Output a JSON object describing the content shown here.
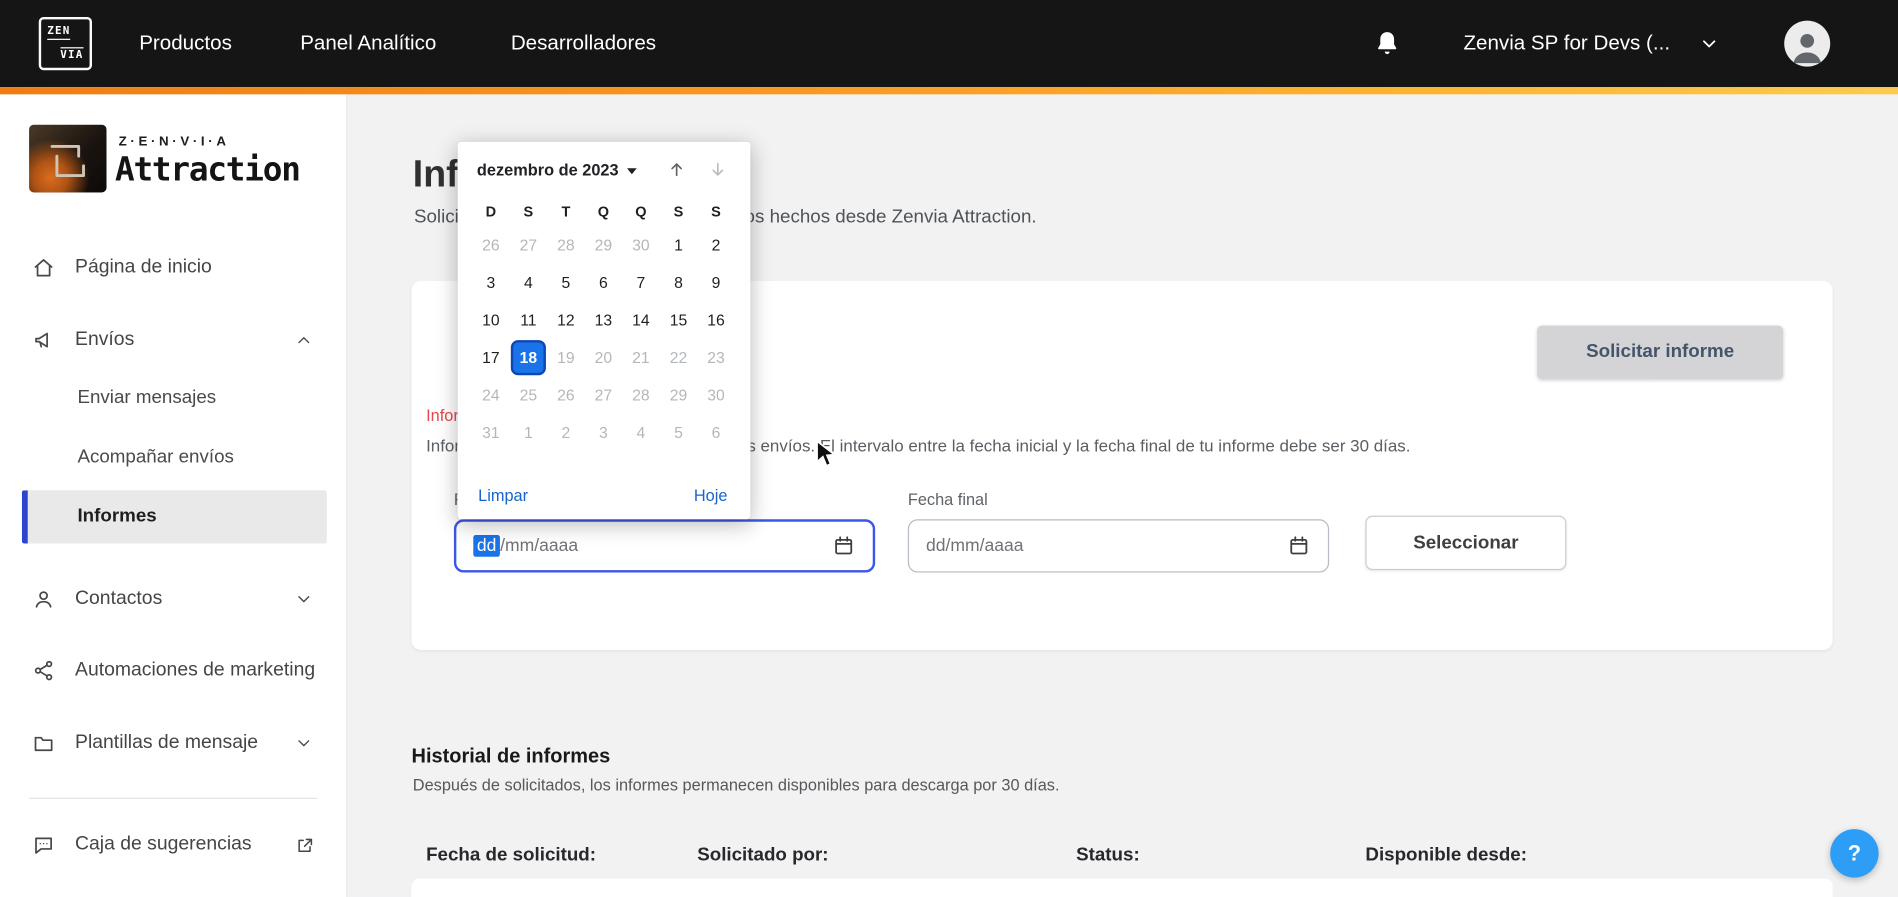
{
  "navbar": {
    "logo_top": "ZEN",
    "logo_bottom": "VIA",
    "items": [
      "Productos",
      "Panel Analítico",
      "Desarrolladores"
    ],
    "account_label": "Zenvia SP for Devs (..."
  },
  "sidebar": {
    "brand_small": "Z·E·N·V·I·A",
    "brand_large": "Attraction",
    "home": "Página de inicio",
    "envios": "Envíos",
    "sub": [
      "Enviar mensajes",
      "Acompañar envíos",
      "Informes"
    ],
    "contactos": "Contactos",
    "automations": "Automaciones de marketing",
    "templates": "Plantillas de mensaje",
    "suggestions": "Caja de sugerencias"
  },
  "page": {
    "title": "Informes de envío",
    "subtitle": "Solicita y descarga los informes de envíos hechos desde Zenvia Attraction."
  },
  "card": {
    "request_button": "Solicitar informe",
    "error_text": "Informa el período de envíos",
    "description": "Informa el período que deseas consultar los envíos. El intervalo entre la fecha inicial y la fecha final de tu informe debe ser 30 días.",
    "start_label": "Fecha inicial",
    "end_label": "Fecha final",
    "dd": "dd",
    "rest": "/mm/aaaa",
    "end_placeholder": "dd/mm/aaaa",
    "select_button": "Seleccionar"
  },
  "calendar": {
    "month_label": "dezembro de 2023",
    "weekdays": [
      "D",
      "S",
      "T",
      "Q",
      "Q",
      "S",
      "S"
    ],
    "days": [
      {
        "d": 26,
        "m": 1
      },
      {
        "d": 27,
        "m": 1
      },
      {
        "d": 28,
        "m": 1
      },
      {
        "d": 29,
        "m": 1
      },
      {
        "d": 30,
        "m": 1
      },
      {
        "d": 1
      },
      {
        "d": 2
      },
      {
        "d": 3
      },
      {
        "d": 4
      },
      {
        "d": 5
      },
      {
        "d": 6
      },
      {
        "d": 7
      },
      {
        "d": 8
      },
      {
        "d": 9
      },
      {
        "d": 10
      },
      {
        "d": 11
      },
      {
        "d": 12
      },
      {
        "d": 13
      },
      {
        "d": 14
      },
      {
        "d": 15
      },
      {
        "d": 16
      },
      {
        "d": 17
      },
      {
        "d": 18,
        "sel": 1
      },
      {
        "d": 19,
        "m": 1
      },
      {
        "d": 20,
        "m": 1
      },
      {
        "d": 21,
        "m": 1
      },
      {
        "d": 22,
        "m": 1
      },
      {
        "d": 23,
        "m": 1
      },
      {
        "d": 24,
        "m": 1
      },
      {
        "d": 25,
        "m": 1
      },
      {
        "d": 26,
        "m": 1
      },
      {
        "d": 27,
        "m": 1
      },
      {
        "d": 28,
        "m": 1
      },
      {
        "d": 29,
        "m": 1
      },
      {
        "d": 30,
        "m": 1
      },
      {
        "d": 31,
        "m": 1
      },
      {
        "d": 1,
        "m": 1
      },
      {
        "d": 2,
        "m": 1
      },
      {
        "d": 3,
        "m": 1
      },
      {
        "d": 4,
        "m": 1
      },
      {
        "d": 5,
        "m": 1
      },
      {
        "d": 6,
        "m": 1
      }
    ],
    "clear_label": "Limpar",
    "today_label": "Hoje"
  },
  "history": {
    "title": "Historial de informes",
    "subtitle": "Después de solicitados, los informes permanecen disponibles para descarga por 30 días.",
    "columns": [
      "Fecha de solicitud:",
      "Solicitado por:",
      "Status:",
      "Disponible desde:"
    ]
  },
  "help": {
    "label": "?"
  },
  "colors": {
    "accent_orange": "#f7941e",
    "selected_day_blue": "#1a73e8",
    "active_item_blue": "#2c44cf",
    "error_red": "#e5484d",
    "help_blue": "#2e9df5"
  }
}
